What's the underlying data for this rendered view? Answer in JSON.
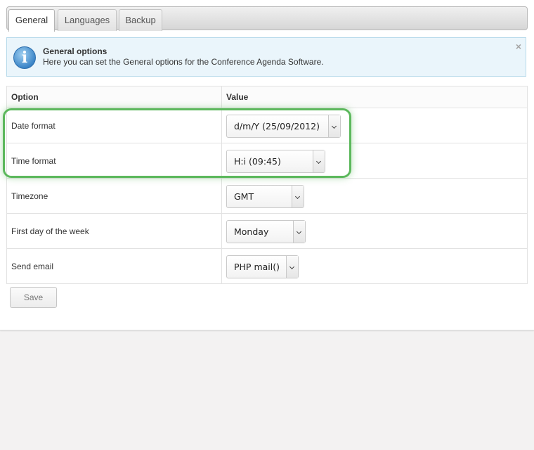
{
  "tabs": [
    {
      "label": "General",
      "active": true
    },
    {
      "label": "Languages",
      "active": false
    },
    {
      "label": "Backup",
      "active": false
    }
  ],
  "info": {
    "icon": "info-icon",
    "icon_glyph": "i",
    "title": "General options",
    "text": "Here you can set the General options for the Conference Agenda Software.",
    "close_glyph": "×"
  },
  "table": {
    "headers": {
      "option": "Option",
      "value": "Value"
    },
    "rows": [
      {
        "option": "Date format",
        "value": "d/m/Y (25/09/2012)"
      },
      {
        "option": "Time format",
        "value": "H:i (09:45)"
      },
      {
        "option": "Timezone",
        "value": "GMT"
      },
      {
        "option": "First day of the week",
        "value": "Monday"
      },
      {
        "option": "Send email",
        "value": "PHP mail()"
      }
    ]
  },
  "highlight": {
    "color": "#5cb85c",
    "covers": [
      "Date format",
      "Time format"
    ]
  },
  "actions": {
    "save_label": "Save"
  }
}
